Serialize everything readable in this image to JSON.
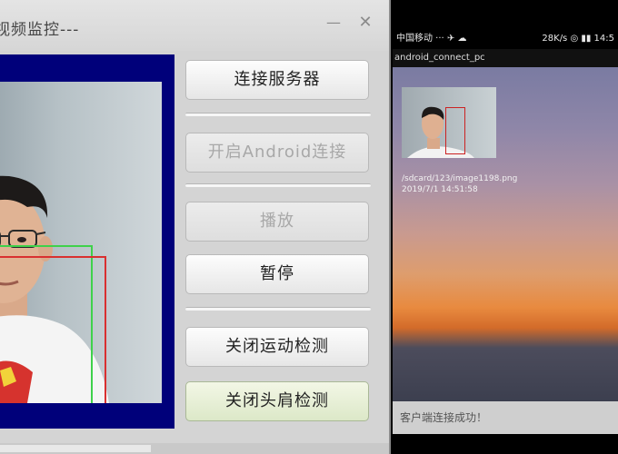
{
  "window": {
    "title": "视频监控---",
    "minimize_glyph": "—",
    "close_glyph": "✕"
  },
  "buttons": {
    "connect_server": "连接服务器",
    "open_android": "开启Android连接",
    "play": "播放",
    "pause": "暂停",
    "close_motion": "关闭运动检测",
    "close_head": "关闭头肩检测"
  },
  "phone": {
    "status_carrier": "中国移动 ··· ✈ ☁",
    "status_right": "28K/s ◎ ▮▮ 14:5",
    "app_title": "android_connect_pc",
    "file_path": "/sdcard/123/image1198.png",
    "file_time": "2019/7/1 14:51:58",
    "toast": "客户端连接成功！"
  }
}
